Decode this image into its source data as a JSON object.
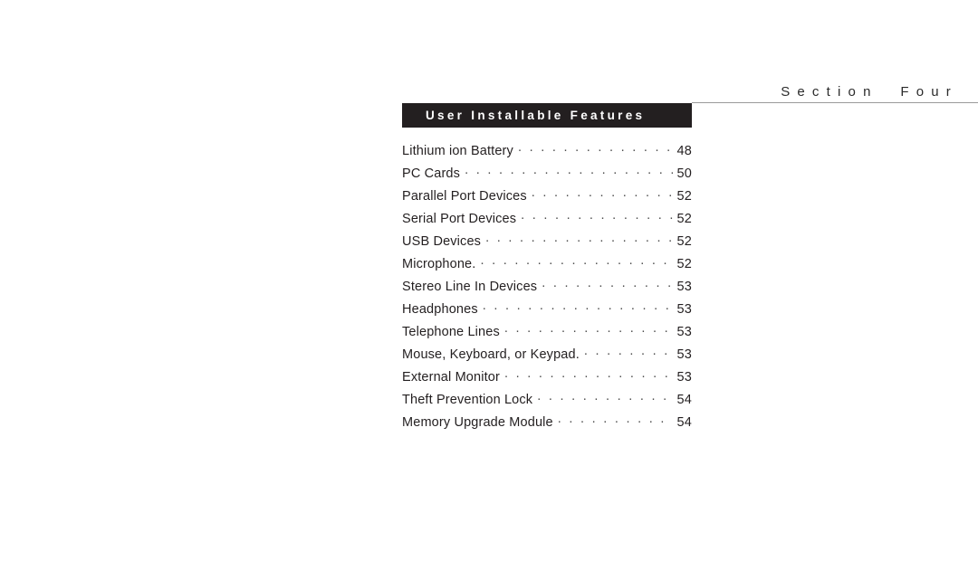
{
  "running_head": {
    "text": "Section  Four"
  },
  "section_title": {
    "text": "User Installable Features"
  },
  "colors": {
    "title_bar_background": "#231F20",
    "title_bar_text": "#FFFFFF",
    "body_text": "#231F20",
    "rule": "#9A9A9A",
    "page_background": "#FFFFFF"
  },
  "toc": {
    "entries": [
      {
        "label": "Lithium ion Battery",
        "page": "48"
      },
      {
        "label": "PC Cards",
        "page": "50"
      },
      {
        "label": "Parallel Port Devices",
        "page": "52"
      },
      {
        "label": "Serial Port Devices",
        "page": "52"
      },
      {
        "label": "USB Devices",
        "page": "52"
      },
      {
        "label": "Microphone.",
        "page": "52"
      },
      {
        "label": "Stereo Line In Devices",
        "page": "53"
      },
      {
        "label": "Headphones",
        "page": "53"
      },
      {
        "label": "Telephone Lines",
        "page": "53"
      },
      {
        "label": "Mouse, Keyboard, or Keypad.",
        "page": "53"
      },
      {
        "label": "External Monitor",
        "page": "53"
      },
      {
        "label": "Theft Prevention Lock",
        "page": "54"
      },
      {
        "label": "Memory Upgrade Module",
        "page": "54"
      }
    ],
    "leader_character": "."
  }
}
